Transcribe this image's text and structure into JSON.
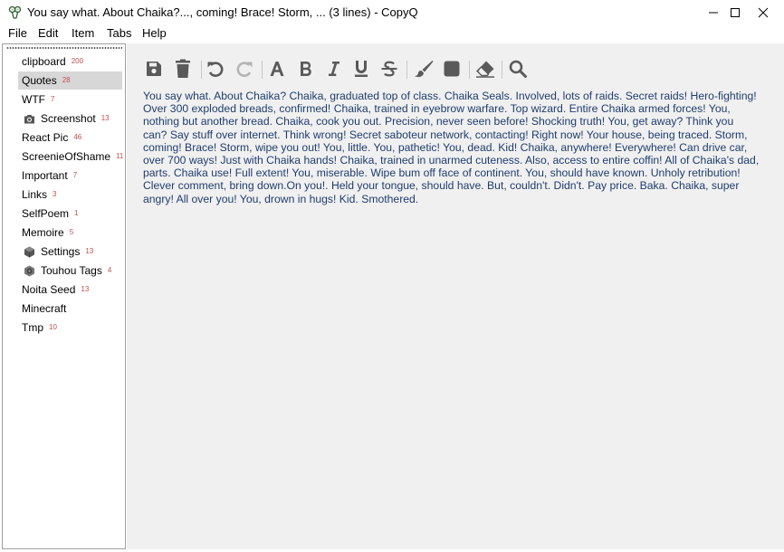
{
  "window": {
    "title": "You say what. About Chaika?..., coming! Brace! Storm, ... (3 lines) - CopyQ",
    "controls": [
      "minimize-icon",
      "maximize-icon",
      "close-icon"
    ]
  },
  "menu": {
    "items": [
      "File",
      "Edit",
      "Item",
      "Tabs",
      "Help"
    ]
  },
  "sidebar": {
    "tabs": [
      {
        "label": "clipboard",
        "count": "200",
        "icon": ""
      },
      {
        "label": "Quotes",
        "count": "28",
        "icon": "",
        "selected": true
      },
      {
        "label": "WTF",
        "count": "7",
        "icon": ""
      },
      {
        "label": "Screenshot",
        "count": "13",
        "icon": "camera-icon"
      },
      {
        "label": "React Pic",
        "count": "46",
        "icon": ""
      },
      {
        "label": "ScreenieOfShame",
        "count": "11",
        "icon": ""
      },
      {
        "label": "Important",
        "count": "7",
        "icon": ""
      },
      {
        "label": "Links",
        "count": "3",
        "icon": ""
      },
      {
        "label": "SelfPoem",
        "count": "1",
        "icon": ""
      },
      {
        "label": "Memoire",
        "count": "5",
        "icon": ""
      },
      {
        "label": "Settings",
        "count": "13",
        "icon": "cube-icon"
      },
      {
        "label": "Touhou Tags",
        "count": "4",
        "icon": "gear-cube-icon"
      },
      {
        "label": "Noita Seed",
        "count": "13",
        "icon": ""
      },
      {
        "label": "Minecraft",
        "count": "",
        "icon": ""
      },
      {
        "label": "Tmp",
        "count": "10",
        "icon": ""
      }
    ]
  },
  "toolbar": {
    "buttons": [
      "save-icon",
      "delete-icon",
      "undo-icon",
      "redo-icon",
      "font-icon",
      "bold-icon",
      "italic-icon",
      "underline-icon",
      "strikethrough-icon",
      "brush-icon",
      "background-color-icon",
      "eraser-icon",
      "search-icon"
    ]
  },
  "editor": {
    "text": "You say what. About Chaika? Chaika, graduated top of class. Chaika Seals. Involved, lots of raids. Secret raids! Hero-fighting! Over 300 exploded breads, confirmed! Chaika, trained in eyebrow warfare. Top wizard. Entire Chaika armed forces! You, nothing but another bread. Chaika, cook you out. Precision, never seen before! Shocking truth! You, get away? Think you can? Say stuff over internet. Think wrong! Secret saboteur network, contacting! Right now! Your house, being traced. Storm, coming! Brace! Storm, wipe you out! You, little. You, pathetic! You, dead. Kid! Chaika, anywhere! Everywhere! Can drive car, over 700 ways! Just with Chaika hands! Chaika, trained in unarmed cuteness. Also, access to entire coffin! All of Chaika's dad, parts. Chaika use! Full extent! You, miserable. Wipe bum off face of continent. You, should have known. Unholy retribution! Clever comment, bring down.On you!. Held your tongue, should have. But, couldn't. Didn't. Pay price. Baka. Chaika, super angry! All over you! You, drown in hugs! Kid. Smothered.",
    "text_color": "#1f3d6e"
  },
  "colors": {
    "count_badge": "#c0504d",
    "selected_tab": "#d7d7d7",
    "panel_bg": "#f0f0f0"
  }
}
